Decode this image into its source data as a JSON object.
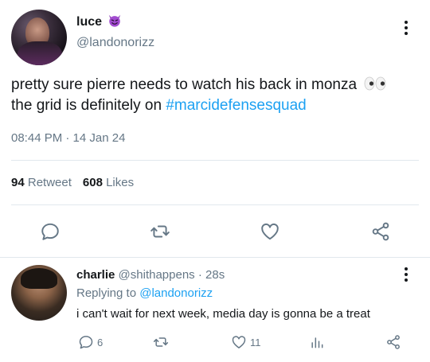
{
  "tweet": {
    "display_name": "luce",
    "name_emoji": "smiling-devil-emoji",
    "handle": "@landonorizz",
    "text_line1": "pretty sure pierre needs to watch his back in monza",
    "text_emoji": "eyes-emoji",
    "text_line2_prefix": "the grid is definitely on ",
    "hashtag": "#marcidefensesquad",
    "timestamp": "08:44 PM · 14 Jan 24",
    "retweet_count": "94",
    "retweet_label": "Retweet",
    "like_count": "608",
    "like_label": "Likes"
  },
  "actions": [
    "reply-icon",
    "retweet-icon",
    "like-icon",
    "share-icon"
  ],
  "reply": {
    "display_name": "charlie",
    "handle": "@shithappens",
    "time": "· 28s",
    "replying_prefix": "Replying to",
    "replying_handle": "@landonorizz",
    "text": "i can't wait for next week, media day is gonna be a treat",
    "reply_count": "6",
    "like_count": "11"
  },
  "colors": {
    "accent": "#1da1f2",
    "muted": "#657786",
    "text": "#14171a",
    "divider": "#e1e8ed"
  }
}
